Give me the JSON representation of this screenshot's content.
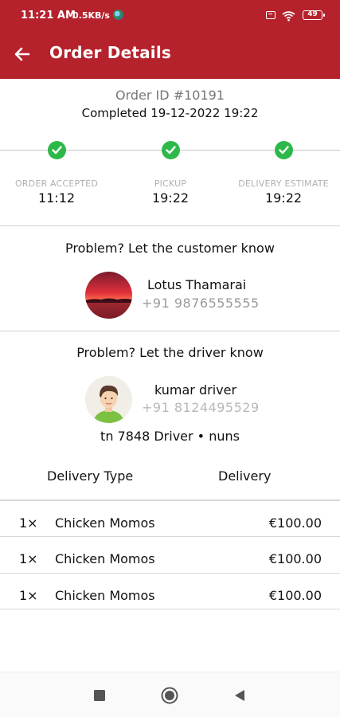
{
  "status_bar": {
    "time": "11:21 AM",
    "speed": "0.5KB/s",
    "battery": "49"
  },
  "appbar": {
    "title": "Order Details",
    "color": "#b5222c"
  },
  "order": {
    "id": "Order ID #10191",
    "completed": "Completed  19-12-2022 19:22"
  },
  "timeline": {
    "check_color": "#2db84a",
    "steps": [
      {
        "label": "ORDER ACCEPTED",
        "time": "11:12"
      },
      {
        "label": "PICKUP",
        "time": "19:22"
      },
      {
        "label": "DELIVERY ESTIMATE",
        "time": "19:22"
      }
    ]
  },
  "customer": {
    "section_title": "Problem? Let the customer know",
    "name": "Lotus Thamarai",
    "phone": "+91 9876555555"
  },
  "driver": {
    "section_title": "Problem? Let the driver know",
    "name": "kumar driver",
    "phone": "+91 8124495529",
    "vehicle": "tn 7848  Driver • nuns"
  },
  "delivery": {
    "type_label": "Delivery Type",
    "type_value": "Delivery"
  },
  "items": [
    {
      "qty": "1×",
      "name": "Chicken Momos",
      "price": "€100.00"
    },
    {
      "qty": "1×",
      "name": "Chicken Momos",
      "price": "€100.00"
    },
    {
      "qty": "1×",
      "name": "Chicken Momos",
      "price": "€100.00"
    }
  ]
}
